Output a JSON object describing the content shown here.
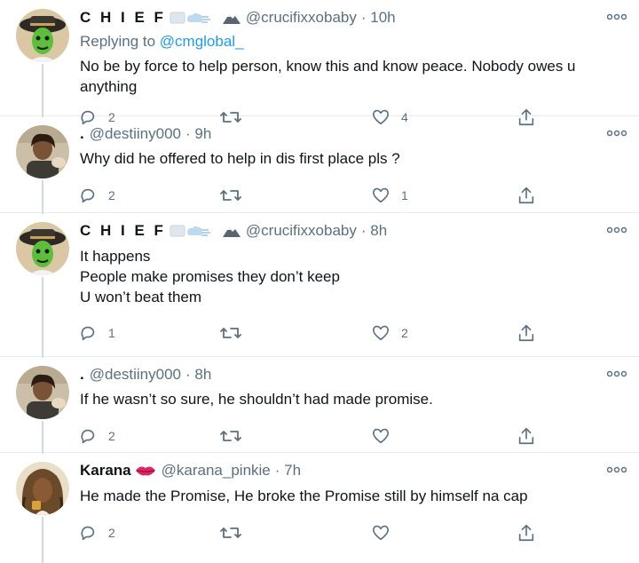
{
  "tweets": [
    {
      "name": "C H I E F",
      "handle": "@crucifixxobaby",
      "time": "· 10h",
      "replying_label": "Replying to ",
      "replying_handle": "@cmglobal_",
      "text_lines": [
        "No be by force to help person, know this and know peace. Nobody owes u",
        "anything"
      ],
      "replies": "2",
      "retweets": "",
      "likes": "4"
    },
    {
      "name": ".",
      "handle": "@destiiny000",
      "time": "· 9h",
      "text_lines": [
        "Why did he offered to help in dis first place pls ?"
      ],
      "replies": "2",
      "retweets": "",
      "likes": "1"
    },
    {
      "name": "C H I E F",
      "handle": "@crucifixxobaby",
      "time": "· 8h",
      "text_lines": [
        "It happens",
        "People make promises they don’t keep",
        "U won’t beat them"
      ],
      "replies": "1",
      "retweets": "",
      "likes": "2"
    },
    {
      "name": ".",
      "handle": "@destiiny000",
      "time": "· 8h",
      "text_lines": [
        "If he wasn’t so sure, he shouldn’t had made promise."
      ],
      "replies": "2",
      "retweets": "",
      "likes": ""
    },
    {
      "name": "Karana",
      "handle": "@karana_pinkie",
      "time": "· 7h",
      "text_lines": [
        "He made the Promise, He broke the Promise still by himself na cap"
      ],
      "replies": "2",
      "retweets": "",
      "likes": ""
    }
  ],
  "icons": {
    "more": "more-icon",
    "reply": "reply-icon",
    "retweet": "retweet-icon",
    "like": "heart-icon",
    "share": "share-icon",
    "lips": "lips-emoji-icon",
    "clouds": "cloud-emoji-icon",
    "mountain": "mountain-emoji-icon"
  },
  "colors": {
    "link": "#1d9bf0",
    "secondary": "#5b7083",
    "divider": "#e6ecf0",
    "lips": "#e0245e"
  }
}
